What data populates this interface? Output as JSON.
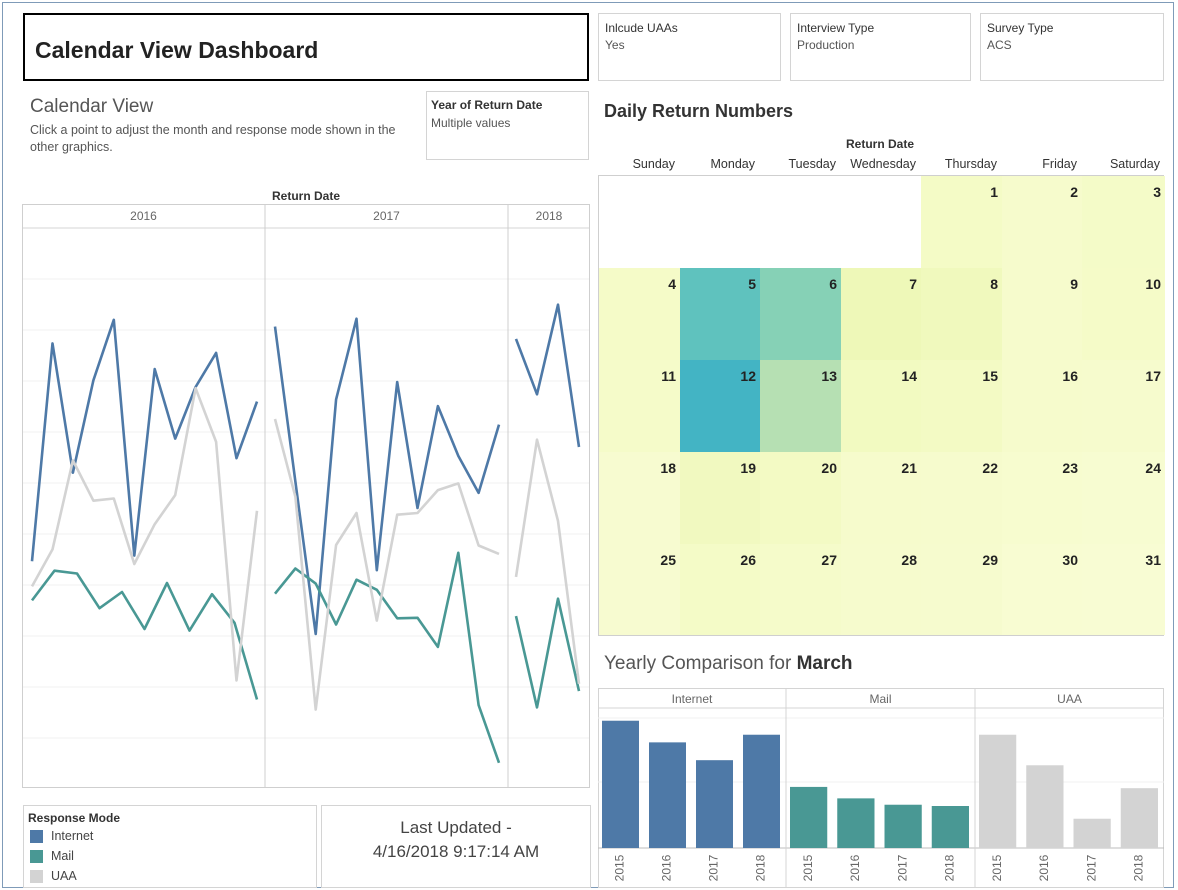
{
  "title": "Calendar View Dashboard",
  "filters": [
    {
      "label": "Inlcude UAAs",
      "value": "Yes"
    },
    {
      "label": "Interview Type",
      "value": "Production"
    },
    {
      "label": "Survey Type",
      "value": "ACS"
    }
  ],
  "calendar_view": {
    "title": "Calendar View",
    "subtitle": "Click a point to adjust the month and response mode shown in the other graphics.",
    "year_filter": {
      "label": "Year of Return Date",
      "value": "Multiple values"
    }
  },
  "legend": {
    "title": "Response Mode",
    "items": [
      {
        "label": "Internet",
        "color": "#4e79a7"
      },
      {
        "label": "Mail",
        "color": "#499894"
      },
      {
        "label": "UAA",
        "color": "#d3d3d3"
      }
    ]
  },
  "last_updated": {
    "line1": "Last Updated -",
    "line2": "4/16/2018 9:17:14 AM"
  },
  "daily_returns": {
    "title": "Daily Return Numbers",
    "axis_label": "Return Date",
    "days_of_week": [
      "Sunday",
      "Monday",
      "Tuesday",
      "Wednesday",
      "Thursday",
      "Friday",
      "Saturday"
    ],
    "weeks": [
      [
        null,
        null,
        null,
        null,
        1,
        2,
        3
      ],
      [
        4,
        5,
        6,
        7,
        8,
        9,
        10
      ],
      [
        11,
        12,
        13,
        14,
        15,
        16,
        17
      ],
      [
        18,
        19,
        20,
        21,
        22,
        23,
        24
      ],
      [
        25,
        26,
        27,
        28,
        29,
        30,
        31
      ]
    ],
    "colors": [
      [
        null,
        null,
        null,
        null,
        "#f4fbc6",
        "#f6fbcc",
        "#f4fbc8"
      ],
      [
        "#f5fbc8",
        "#5fc2be",
        "#86d1b6",
        "#eef8b8",
        "#f0f9bd",
        "#f6fbcc",
        "#f5fbc8"
      ],
      [
        "#f5fbc9",
        "#43b4c4",
        "#b6e0b3",
        "#f2fac1",
        "#f3fac4",
        "#f6fbcc",
        "#f6fbcd"
      ],
      [
        "#f7fbd0",
        "#f1f9c0",
        "#f3fac4",
        "#f6fbcc",
        "#f6fbcd",
        "#f7fccf",
        "#f7fcd1"
      ],
      [
        "#f7fbd0",
        "#f4fbc7",
        "#f5fbca",
        "#f6fbcd",
        "#f6fbce",
        "#f8fcd2",
        "#f8fcd3"
      ]
    ]
  },
  "chart_data": [
    {
      "type": "line",
      "xlabel": "Return Date",
      "panels": [
        "2016",
        "2017",
        "2018"
      ],
      "series": [
        {
          "name": "Internet",
          "color": "#4e79a7",
          "values": [
            [
              40.5,
              79.4,
              56.3,
              72.8,
              83.6,
              41.5,
              74.8,
              62.4,
              71.6,
              77.7,
              58.9,
              69.0
            ],
            [
              82.4,
              54.7,
              27.5,
              69.4,
              83.8,
              38.9,
              72.5,
              50.0,
              68.2,
              59.3,
              52.7,
              64.9
            ],
            [
              80.2,
              70.3,
              86.3,
              60.9
            ]
          ]
        },
        {
          "name": "Mail",
          "color": "#499894",
          "values": [
            [
              33.5,
              38.8,
              38.3,
              32.1,
              35.0,
              28.4,
              36.6,
              28.1,
              34.6,
              29.5,
              15.8
            ],
            [
              34.7,
              39.2,
              36.5,
              29.2,
              37.2,
              35.4,
              30.3,
              30.4,
              25.2,
              42.0,
              14.8,
              4.5
            ],
            [
              30.7,
              14.4,
              33.8,
              17.3
            ]
          ]
        },
        {
          "name": "UAA",
          "color": "#d3d3d3",
          "values": [
            [
              36.0,
              42.6,
              58.5,
              51.3,
              51.7,
              40.0,
              47.1,
              52.3,
              71.4,
              61.8,
              19.2,
              49.5
            ],
            [
              65.9,
              52.0,
              14.0,
              43.4,
              49.1,
              29.9,
              48.8,
              49.1,
              53.2,
              54.4,
              43.3,
              41.8
            ],
            [
              37.7,
              62.2,
              47.7,
              18.6
            ]
          ]
        }
      ]
    },
    {
      "type": "bar",
      "title": "Yearly Comparison for March",
      "title_prefix": "Yearly Comparison for",
      "title_month": "March",
      "panels": [
        "Internet",
        "Mail",
        "UAA"
      ],
      "categories": [
        "2015",
        "2016",
        "2017",
        "2018"
      ],
      "ylim": [
        0,
        110
      ],
      "series": [
        {
          "name": "Internet",
          "color": "#4e79a7",
          "values": [
            100,
            83,
            69,
            89
          ]
        },
        {
          "name": "Mail",
          "color": "#499894",
          "values": [
            48,
            39,
            34,
            33
          ]
        },
        {
          "name": "UAA",
          "color": "#d3d3d3",
          "values": [
            89,
            65,
            23,
            47
          ]
        }
      ]
    }
  ]
}
